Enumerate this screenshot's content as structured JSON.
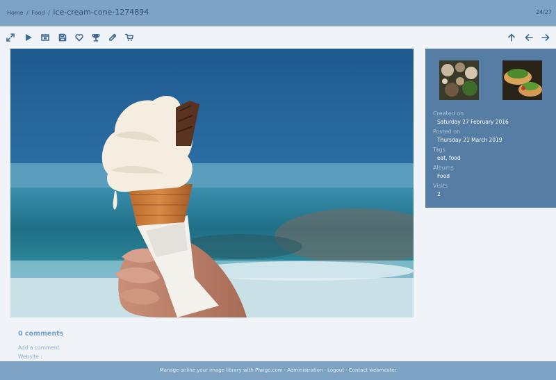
{
  "breadcrumb": {
    "home": "Home",
    "separator": "/",
    "album": "Food",
    "current": "ice-cream-cone-1274894"
  },
  "counter": "24/27",
  "toolbar": {
    "left_icons": [
      "expand-icon",
      "play-icon",
      "slideshow-icon",
      "save-icon",
      "heart-icon",
      "trophy-icon",
      "pencil-icon",
      "cart-icon"
    ],
    "right_icons": [
      "arrow-up-icon",
      "arrow-left-icon",
      "arrow-right-icon"
    ]
  },
  "info": {
    "created_label": "Created on",
    "created_value": "Saturday 27 February 2016",
    "posted_label": "Posted on",
    "posted_value": "Thursday 21 March 2019",
    "tags_label": "Tags",
    "tags": [
      "eat",
      "food"
    ],
    "tags_separator": ",",
    "albums_label": "Albums",
    "albums_value": "Food",
    "visits_label": "Visits",
    "visits_value": "2"
  },
  "comments": {
    "title": "0 comments",
    "add": "Add a comment",
    "website": "Website :"
  },
  "footer": {
    "prefix": "Manage online your image library with",
    "piwigo": "Piwigo.com",
    "sep": "·",
    "administration": "Administration",
    "logout": "Logout",
    "contact": "Contact webmaster"
  },
  "colors": {
    "header_bg": "#7fa3c3",
    "info_bg": "#567da3",
    "page_bg": "#f0f3f7",
    "accent": "#3d6a96"
  }
}
